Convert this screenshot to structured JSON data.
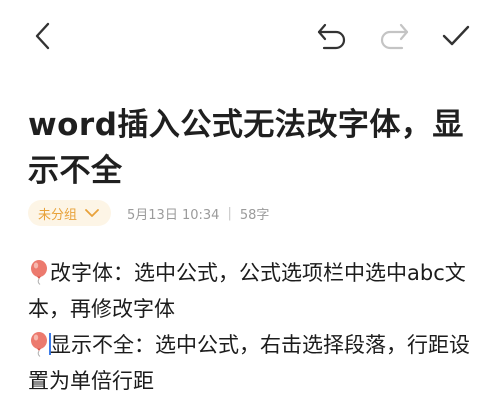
{
  "toolbar": {
    "back_icon": "chevron-left-icon",
    "undo_icon": "undo-icon",
    "redo_icon": "redo-icon",
    "done_icon": "checkmark-icon",
    "undo_color": "#333333",
    "redo_color": "#c4c4c4"
  },
  "note": {
    "title": "word插入公式无法改字体，显示不全",
    "group_label": "未分组",
    "date": "5月13日 10:34",
    "separator": "|",
    "word_count": "58字",
    "paragraphs": [
      {
        "icon": "balloon-icon",
        "text": "改字体：选中公式，公式选项栏中选中abc文本，再修改字体"
      },
      {
        "icon": "balloon-icon",
        "text": "显示不全：选中公式，右击选择段落，行距设置为单倍行距"
      }
    ]
  },
  "colors": {
    "accent": "#e8a23a",
    "accent_bg": "#fdf5e6",
    "meta_text": "#9b9b9b",
    "caret": "#3b7be8",
    "balloon": "#e8706a"
  }
}
